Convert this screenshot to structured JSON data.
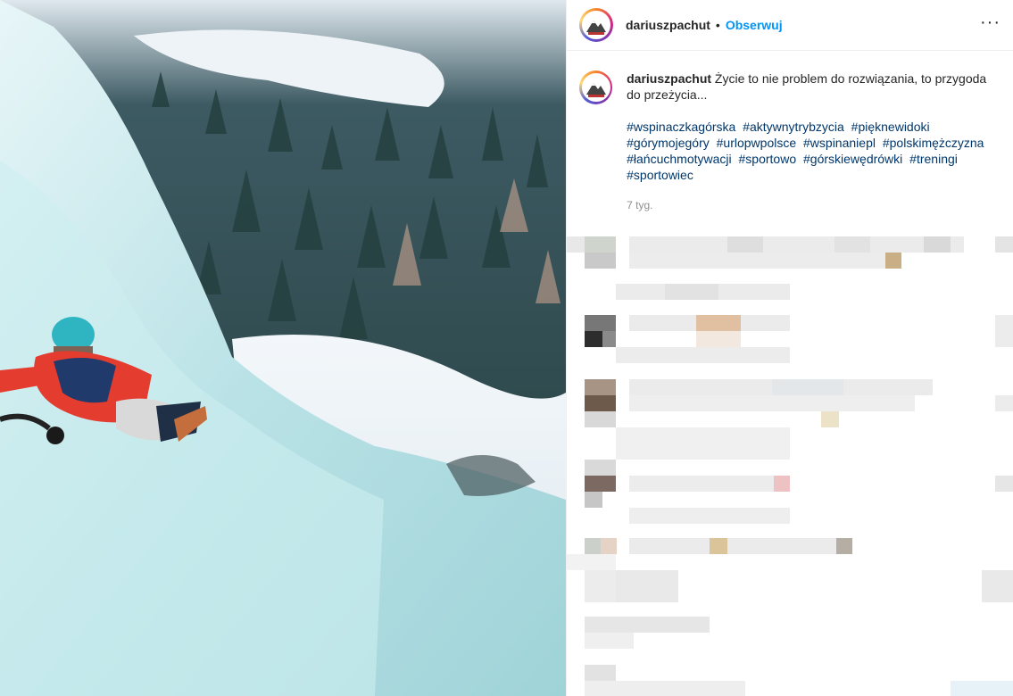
{
  "post": {
    "username": "dariuszpachut",
    "separator": "•",
    "follow_label": "Obserwuj",
    "more_label": "···",
    "caption_text": "Życie to nie problem do rozwiązania, to przygoda do przeżycia...",
    "hashtags": [
      "#wspinaczkagórska",
      "#aktywnytrybzycia",
      "#pięknewidoki",
      "#górymojegóry",
      "#urlopwpolsce",
      "#wspinaniepl",
      "#polskimężczyzna",
      "#łańcuchmotywacji",
      "#sportowo",
      "#górskiewędrówki",
      "#treningi",
      "#sportowiec"
    ],
    "time_ago": "7 tyg."
  },
  "colors": {
    "accent_link": "#0095f6",
    "hashtag": "#00376b",
    "muted": "#8e8e8e"
  },
  "icons": {
    "avatar": "mountain-logo-avatar",
    "more": "more-options-icon"
  }
}
